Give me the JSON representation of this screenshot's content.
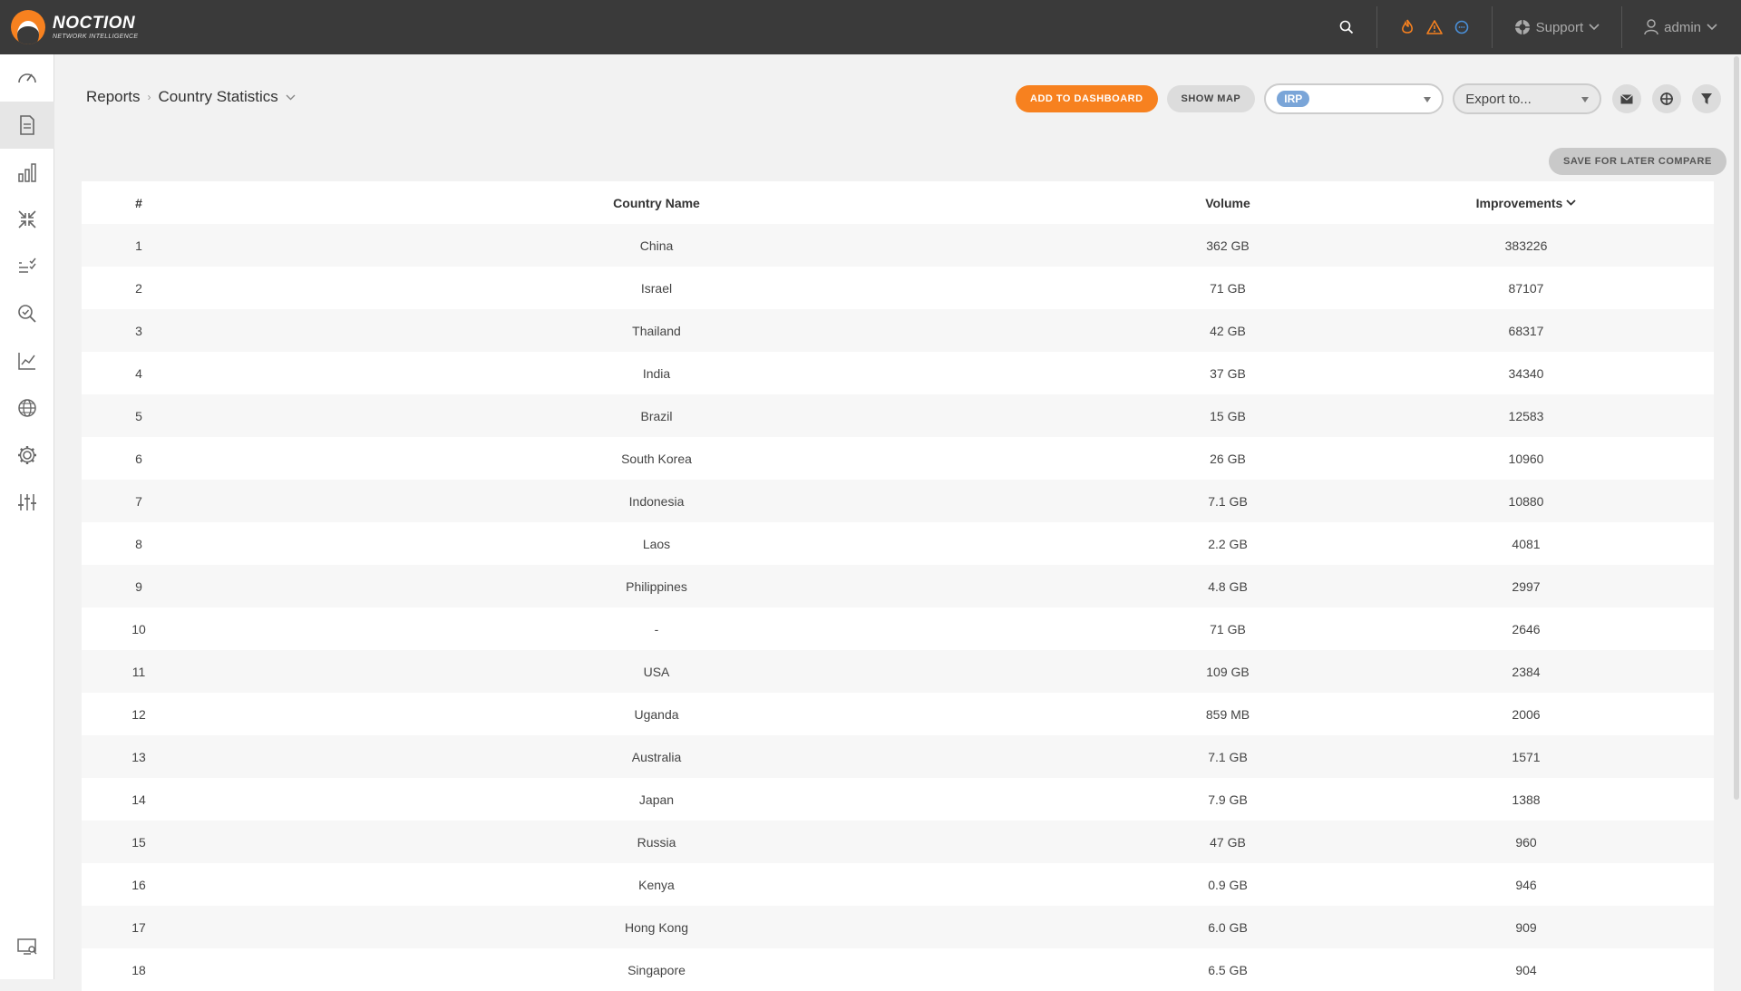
{
  "brand": {
    "name": "NOCTION",
    "tagline": "NETWORK INTELLIGENCE"
  },
  "header": {
    "support_label": "Support",
    "user_label": "admin",
    "colors": {
      "fire": "#f7811f",
      "warning": "#f7811f",
      "chat": "#4a90d9"
    }
  },
  "sidebar": {
    "items": [
      {
        "icon": "speedometer-icon"
      },
      {
        "icon": "document-icon",
        "active": true
      },
      {
        "icon": "bar-chart-icon"
      },
      {
        "icon": "compress-arrows-icon"
      },
      {
        "icon": "checklist-icon"
      },
      {
        "icon": "search-check-icon"
      },
      {
        "icon": "line-chart-icon"
      },
      {
        "icon": "globe-icon"
      },
      {
        "icon": "gear-icon"
      },
      {
        "icon": "sliders-icon"
      }
    ],
    "bottom_icon": "monitor-search-icon"
  },
  "breadcrumb": {
    "parent": "Reports",
    "current": "Country Statistics"
  },
  "toolbar": {
    "add_to_dashboard": "ADD TO DASHBOARD",
    "show_map": "SHOW MAP",
    "irp_tag": "IRP",
    "export_placeholder": "Export to...",
    "save_compare": "SAVE FOR LATER COMPARE"
  },
  "table": {
    "headers": {
      "index": "#",
      "country": "Country Name",
      "volume": "Volume",
      "improvements": "Improvements"
    },
    "rows": [
      {
        "n": "1",
        "country": "China",
        "volume": "362 GB",
        "improvements": "383226"
      },
      {
        "n": "2",
        "country": "Israel",
        "volume": "71 GB",
        "improvements": "87107"
      },
      {
        "n": "3",
        "country": "Thailand",
        "volume": "42 GB",
        "improvements": "68317"
      },
      {
        "n": "4",
        "country": "India",
        "volume": "37 GB",
        "improvements": "34340"
      },
      {
        "n": "5",
        "country": "Brazil",
        "volume": "15 GB",
        "improvements": "12583"
      },
      {
        "n": "6",
        "country": "South Korea",
        "volume": "26 GB",
        "improvements": "10960"
      },
      {
        "n": "7",
        "country": "Indonesia",
        "volume": "7.1 GB",
        "improvements": "10880"
      },
      {
        "n": "8",
        "country": "Laos",
        "volume": "2.2 GB",
        "improvements": "4081"
      },
      {
        "n": "9",
        "country": "Philippines",
        "volume": "4.8 GB",
        "improvements": "2997"
      },
      {
        "n": "10",
        "country": "-",
        "volume": "71 GB",
        "improvements": "2646"
      },
      {
        "n": "11",
        "country": "USA",
        "volume": "109 GB",
        "improvements": "2384"
      },
      {
        "n": "12",
        "country": "Uganda",
        "volume": "859 MB",
        "improvements": "2006"
      },
      {
        "n": "13",
        "country": "Australia",
        "volume": "7.1 GB",
        "improvements": "1571"
      },
      {
        "n": "14",
        "country": "Japan",
        "volume": "7.9 GB",
        "improvements": "1388"
      },
      {
        "n": "15",
        "country": "Russia",
        "volume": "47 GB",
        "improvements": "960"
      },
      {
        "n": "16",
        "country": "Kenya",
        "volume": "0.9 GB",
        "improvements": "946"
      },
      {
        "n": "17",
        "country": "Hong Kong",
        "volume": "6.0 GB",
        "improvements": "909"
      },
      {
        "n": "18",
        "country": "Singapore",
        "volume": "6.5 GB",
        "improvements": "904"
      }
    ]
  }
}
